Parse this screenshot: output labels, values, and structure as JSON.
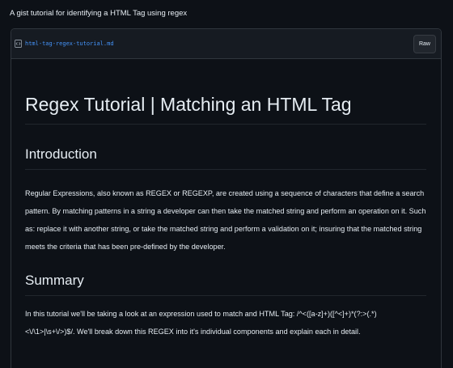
{
  "gist": {
    "description": "A gist tutorial for identifying a HTML Tag using regex"
  },
  "file": {
    "name": "html-tag-regex-tutorial.md",
    "icon": "code-file-icon",
    "raw_label": "Raw"
  },
  "markdown": {
    "title": "Regex Tutorial | Matching an HTML Tag",
    "sections": [
      {
        "heading": "Introduction",
        "paragraph": "Regular Expressions, also known as REGEX or REGEXP, are created using a sequence of characters that define a search pattern. By matching patterns in a string a developer can then take the matched string and perform an operation on it. Such as: replace it with another string, or take the matched string and perform a validation on it; insuring that the matched string meets the criteria that has been pre-defined by the developer."
      },
      {
        "heading": "Summary",
        "paragraph": "In this tutorial we'll be taking a look at an expression used to match and HTML Tag: /^<([a-z]+)([^<]+)*(?:>(.*)<\\/\\1>|\\s+\\/>)$/. We'll break down this REGEX into it's individual components and explain each in detail."
      }
    ]
  },
  "colors": {
    "background": "#0d1117",
    "header_background": "#161b22",
    "border": "#30363d",
    "link": "#4493f8",
    "text": "#e6edf3"
  }
}
